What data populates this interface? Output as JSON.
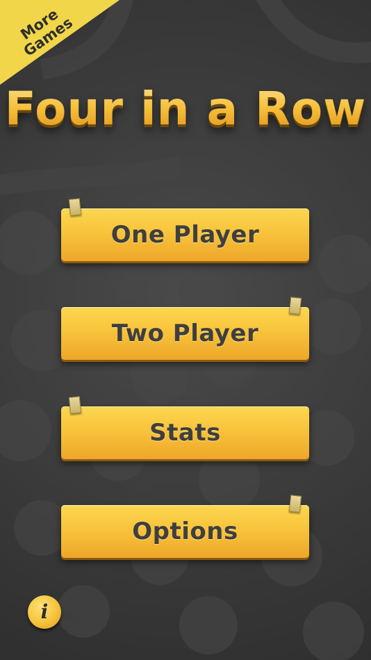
{
  "app": {
    "title": "Four in a Row"
  },
  "corner_ribbon": {
    "line1": "More",
    "line2": "Games"
  },
  "menu": {
    "buttons": [
      {
        "id": "one-player",
        "label": "One Player"
      },
      {
        "id": "two-player",
        "label": "Two Player"
      },
      {
        "id": "stats",
        "label": "Stats"
      },
      {
        "id": "options",
        "label": "Options"
      }
    ]
  },
  "info_button": {
    "glyph": "i",
    "icon": "info-icon"
  },
  "colors": {
    "background": "#3a3a3a",
    "accent_yellow": "#f8c43b",
    "title_gold": "#f2b52e",
    "button_text": "#3f3f3f"
  }
}
